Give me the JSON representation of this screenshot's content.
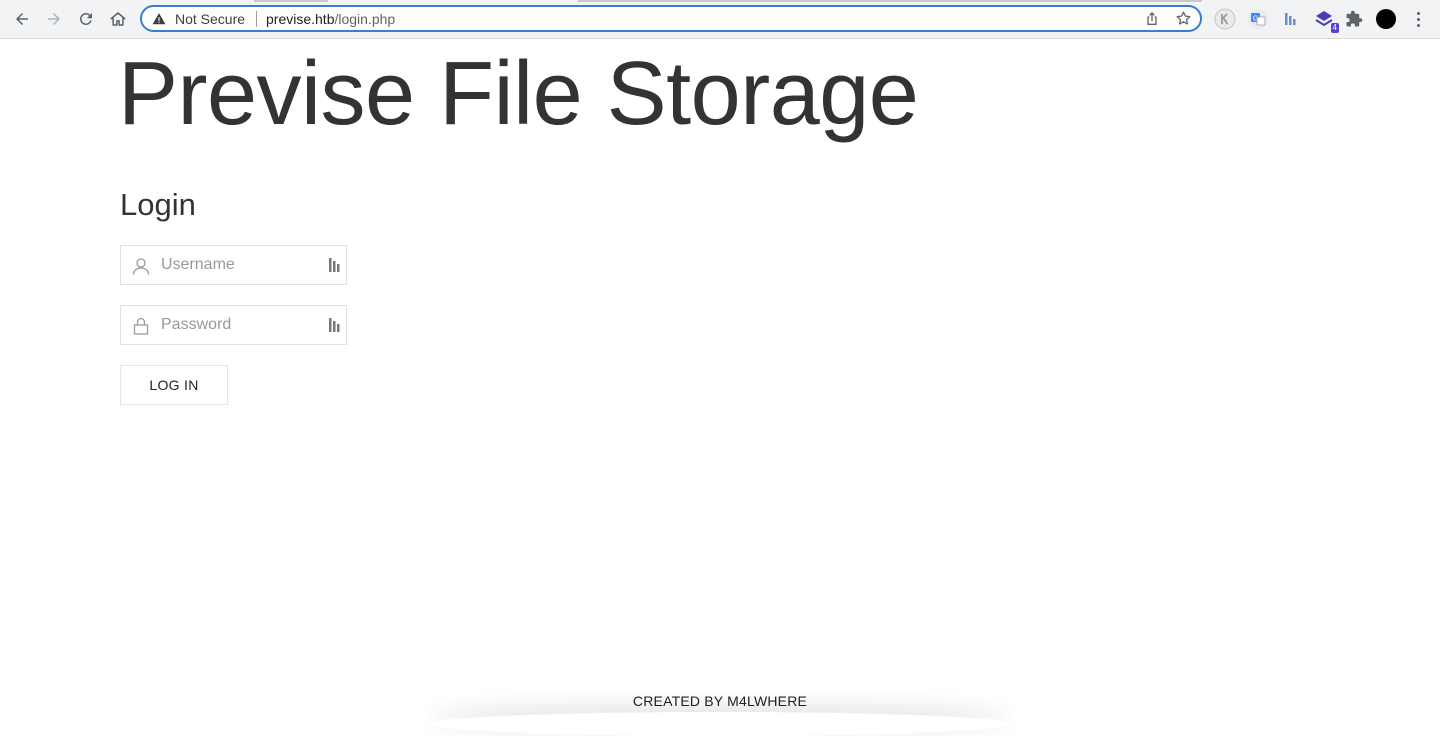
{
  "browser": {
    "security_label": "Not Secure",
    "url_host": "previse.htb",
    "url_path": "/login.php",
    "extension_badge": "4"
  },
  "page": {
    "title": "Previse File Storage",
    "subtitle": "Login",
    "username_placeholder": "Username",
    "password_placeholder": "Password",
    "login_button": "LOG IN",
    "footer": "CREATED BY M4LWHERE"
  }
}
